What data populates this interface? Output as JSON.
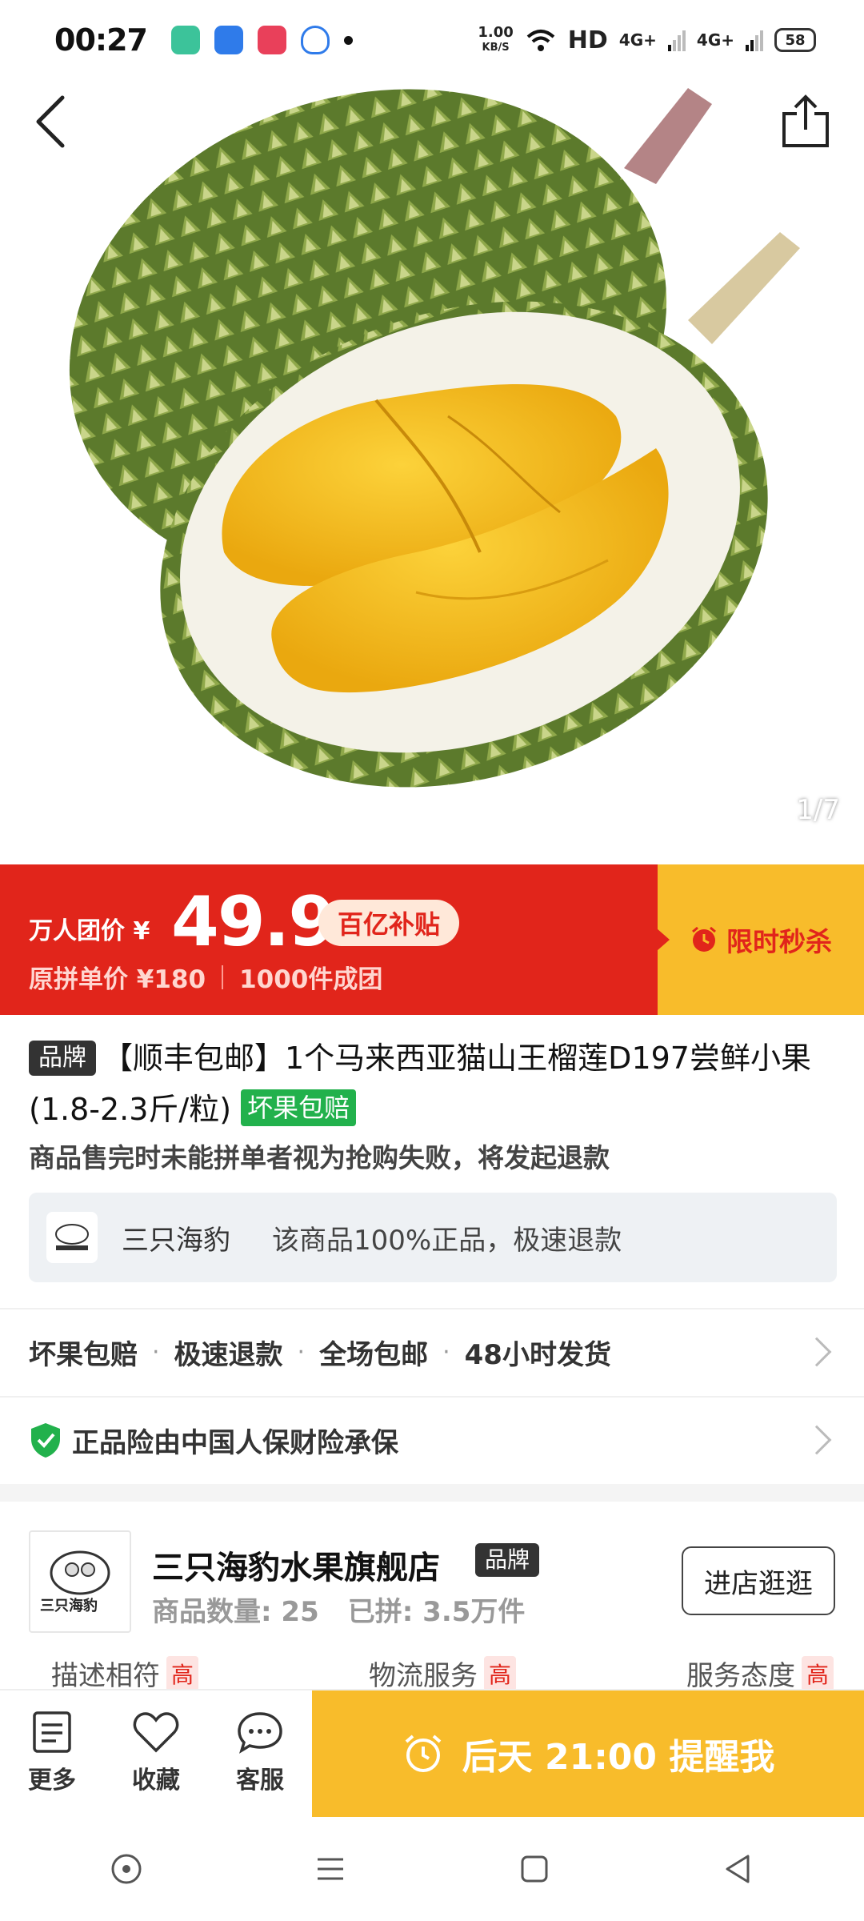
{
  "status_bar": {
    "time": "00:27",
    "net_speed_value": "1.00",
    "net_speed_unit": "KB/S",
    "hd": "HD",
    "signal1": "4G+",
    "signal2": "4G+",
    "battery": "58"
  },
  "hero": {
    "image_counter": "1/7"
  },
  "price": {
    "label": "万人团价 ¥",
    "value": "49.9",
    "subsidy_badge": "百亿补贴",
    "original_price": "原拼单价 ¥180",
    "group_count": "1000件成团",
    "flash_sale": "限时秒杀"
  },
  "product": {
    "brand_tag": "品牌",
    "title": "【顺丰包邮】1个马来西亚猫山王榴莲D197尝鲜小果(1.8-2.3斤/粒)",
    "guarantee_tag": "坏果包赔",
    "notice": "商品售完时未能拼单者视为抢购失败，将发起退款"
  },
  "auth": {
    "shop_short": "三只海豹",
    "desc": "该商品100%正品，极速退款"
  },
  "services": {
    "items": [
      "坏果包赔",
      "极速退款",
      "全场包邮",
      "48小时发货"
    ],
    "insurance": "正品险由中国人保财险承保"
  },
  "store": {
    "logo_text": "三只海豹",
    "name": "三只海豹水果旗舰店",
    "brand_tag": "品牌",
    "goods_count": "商品数量: 25",
    "sold": "已拼: 3.5万件",
    "visit_button": "进店逛逛",
    "ratings": [
      {
        "label": "描述相符",
        "level": "高"
      },
      {
        "label": "物流服务",
        "level": "高"
      },
      {
        "label": "服务态度",
        "level": "高"
      }
    ]
  },
  "bottom_bar": {
    "more": "更多",
    "favorite": "收藏",
    "service": "客服",
    "remind": "后天 21:00 提醒我"
  },
  "colors": {
    "accent_red": "#e1251b",
    "accent_yellow": "#f8bc2b",
    "green": "#22b14c"
  }
}
